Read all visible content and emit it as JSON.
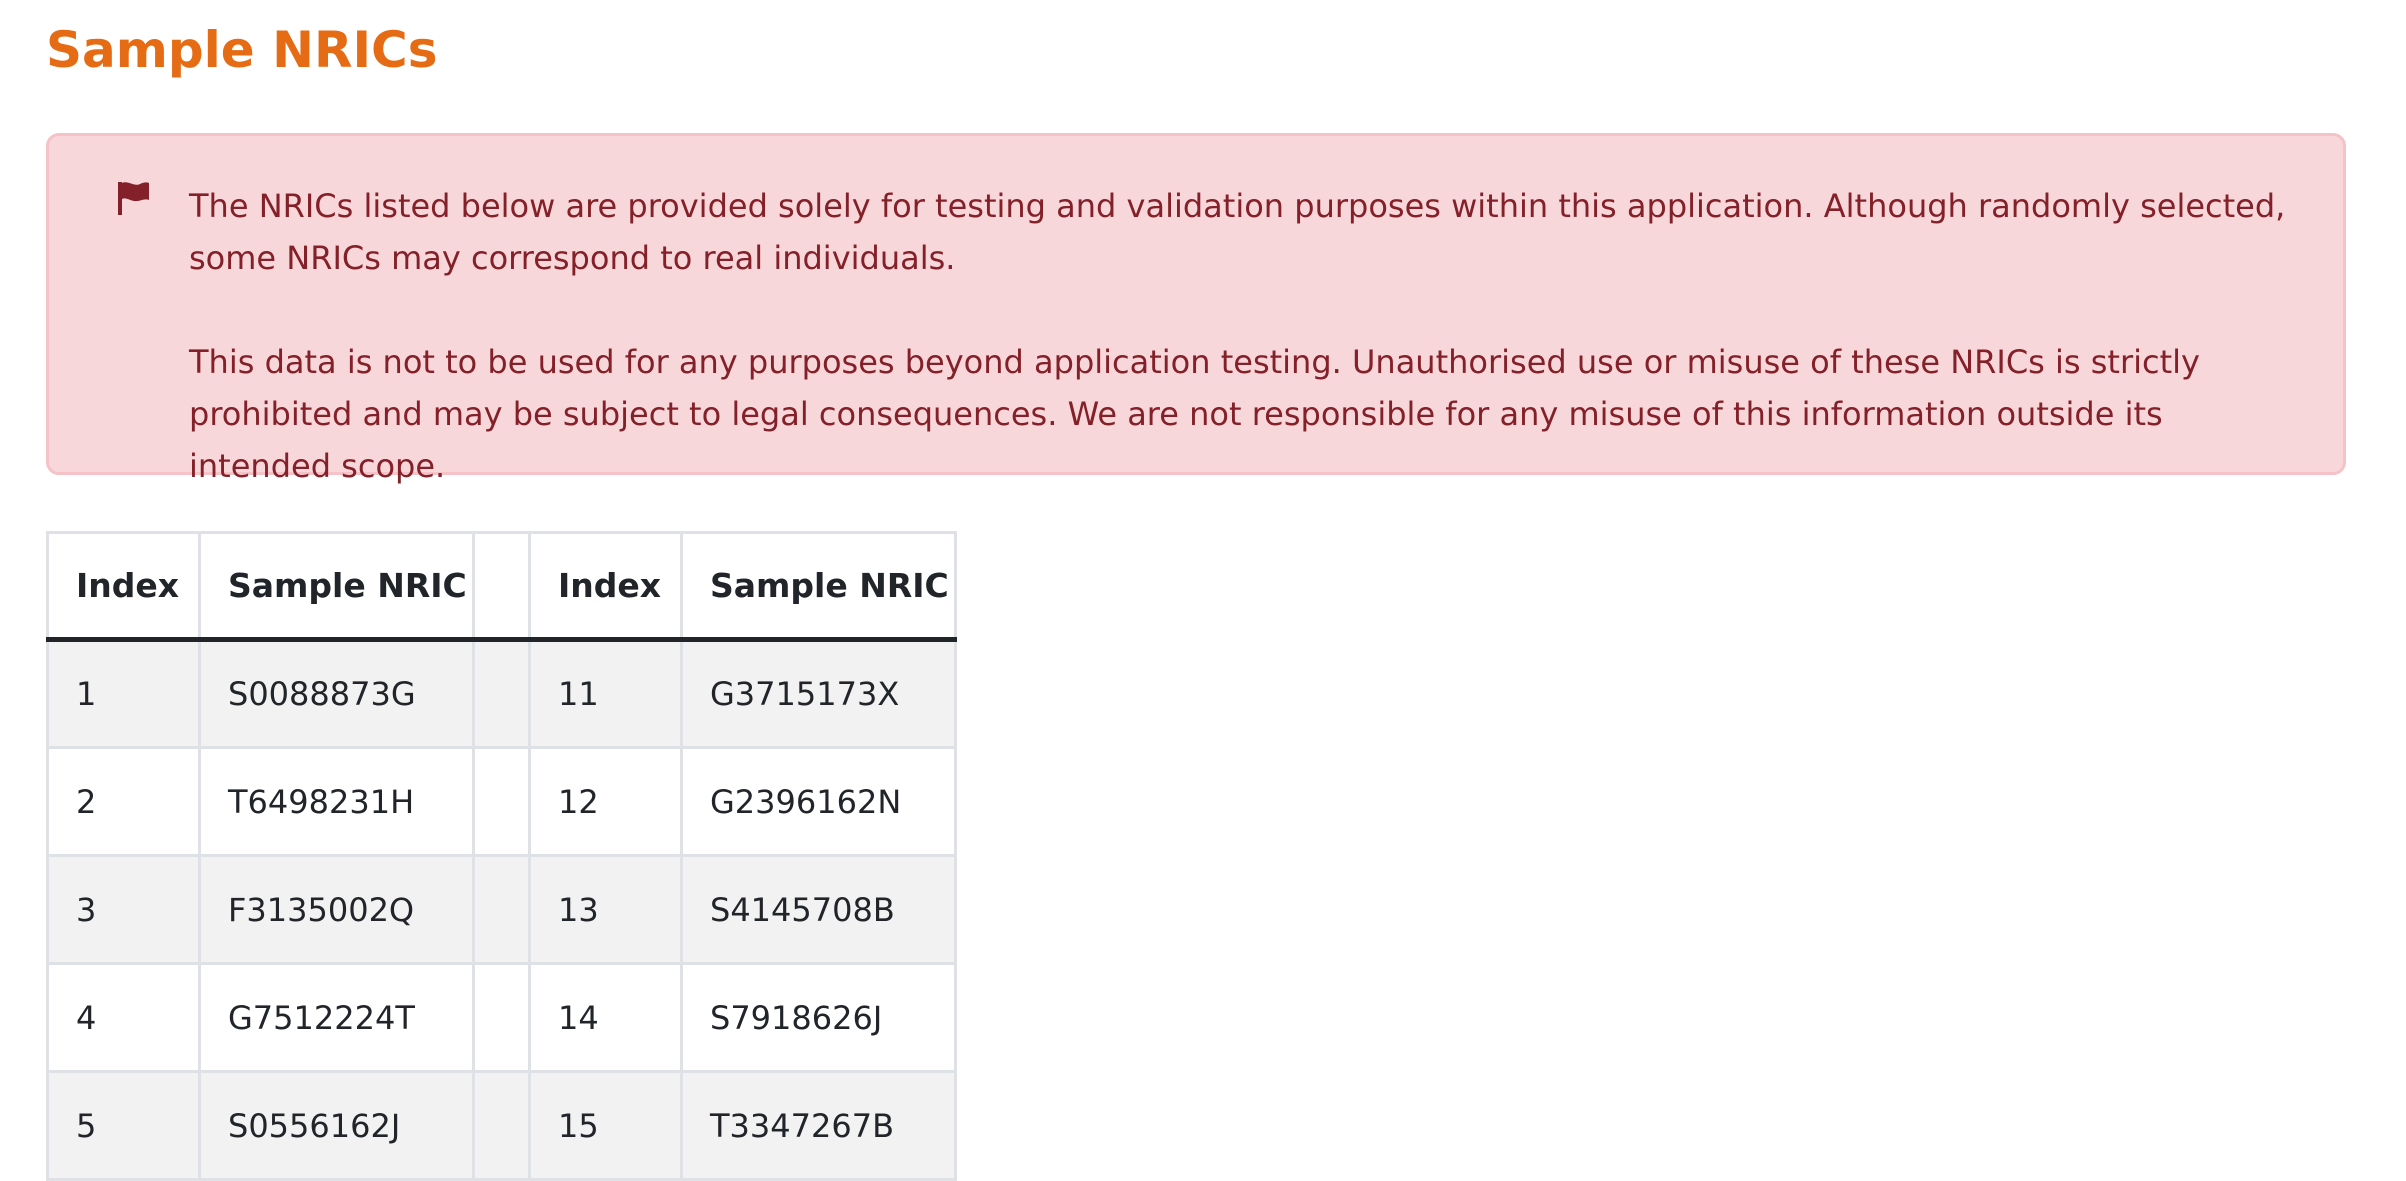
{
  "page": {
    "title": "Sample NRICs"
  },
  "alert": {
    "icon": "flag-icon",
    "color": "#842029",
    "background": "#f8d7da",
    "paragraph1": "The NRICs listed below are provided solely for testing and validation purposes within this application. Although randomly selected, some NRICs may correspond to real individuals.",
    "paragraph2": "This data is not to be used for any purposes beyond application testing. Unauthorised use or misuse of these NRICs is strictly prohibited and may be subject to legal consequences. We are not responsible for any misuse of this information outside its intended scope."
  },
  "table": {
    "headers": [
      "Index",
      "Sample NRIC",
      "",
      "Index",
      "Sample NRIC"
    ],
    "rows": [
      [
        "1",
        "S0088873G",
        "",
        "11",
        "G3715173X"
      ],
      [
        "2",
        "T6498231H",
        "",
        "12",
        "G2396162N"
      ],
      [
        "3",
        "F3135002Q",
        "",
        "13",
        "S4145708B"
      ],
      [
        "4",
        "G7512224T",
        "",
        "14",
        "S7918626J"
      ],
      [
        "5",
        "S0556162J",
        "",
        "15",
        "T3347267B"
      ]
    ]
  },
  "colors": {
    "title": "#e56b14",
    "text": "#212529",
    "row_stripe": "#f2f2f2"
  }
}
